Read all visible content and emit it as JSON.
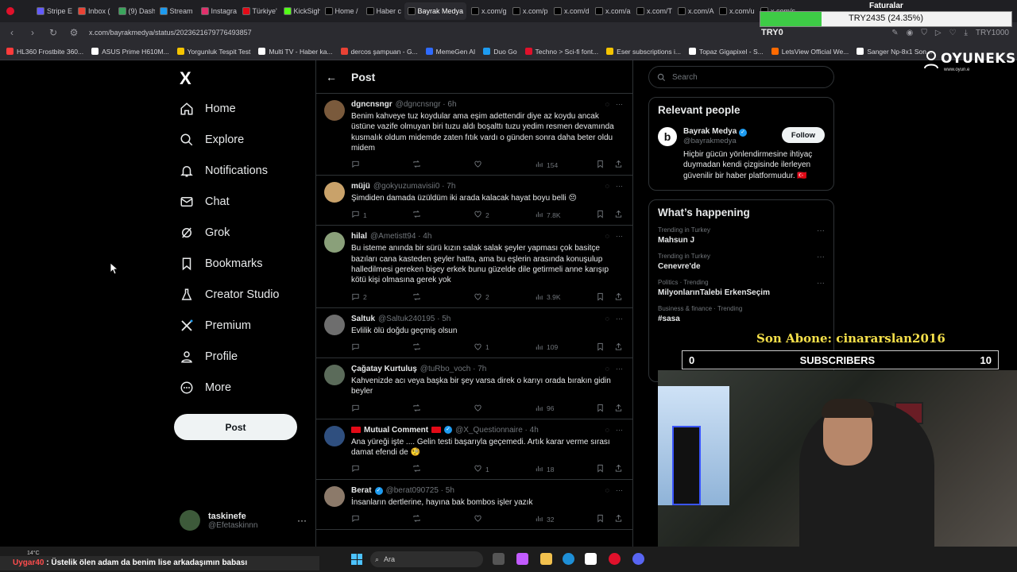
{
  "browser": {
    "tabs": [
      "Stripe E",
      "Inbox (",
      "(9) Dash",
      "Stream",
      "Instagra",
      "Türkiye'",
      "KickSigh",
      "Home /",
      "Haber c",
      "Bayrak Medya",
      "x.com/g",
      "x.com/p",
      "x.com/d",
      "x.com/a",
      "x.com/T",
      "x.com/A",
      "x.com/u",
      "x.com/s"
    ],
    "url": "x.com/bayrakmedya/status/2023621679776493857",
    "bookmarks": [
      "HL360 Frostbite 360...",
      "ASUS Prime H610M...",
      "Yorgunluk Tespit Test",
      "Multi TV - Haber ka...",
      "dercos şampuan - G...",
      "MemeGen AI",
      "Duo Go",
      "Techno > Sci-fi font...",
      "Eser subscriptions i...",
      "Topaz Gigapixel - S...",
      "LetsView Official We...",
      "Sanger Np-8x1 Son..."
    ],
    "right_label": "TRY1000"
  },
  "nav": {
    "logo": "X",
    "items": [
      "Home",
      "Explore",
      "Notifications",
      "Chat",
      "Grok",
      "Bookmarks",
      "Creator Studio",
      "Premium",
      "Profile",
      "More"
    ],
    "post_button": "Post",
    "account_name": "taskinefe",
    "account_handle": "@Efetaskinnn",
    "account_more": "···"
  },
  "timeline": {
    "back": "←",
    "title": "Post",
    "tweets": [
      {
        "name": "dgncnsngr",
        "handle": "@dgncnsngr · 6h",
        "text": "Benim kahveye tuz koydular ama eşim adettendir diye az koydu ancak üstüne vazife olmuyan biri tuzu aldı boşalttı tuzu yedim resmen devamında kusmalık oldum midemde zaten fıtık vardı o günden sonra daha beter oldu midem",
        "replies": "",
        "reposts": "",
        "likes": "",
        "views": "154",
        "color": "#7a5a3c"
      },
      {
        "name": "müjü",
        "handle": "@gokyuzumavisii0 · 7h",
        "text": "Şimdiden damada üzüldüm iki arada kalacak hayat boyu belli 😔",
        "replies": "1",
        "reposts": "",
        "likes": "2",
        "views": "7.8K",
        "color": "#c9a26a"
      },
      {
        "name": "hilal",
        "handle": "@Ametistt94 · 4h",
        "text": "Bu isteme anında bir sürü kızın salak salak şeyler yapması çok basitçe bazıları cana kasteden şeyler hatta, ama bu eşlerin arasında konuşulup halledilmesi gereken bişey erkek bunu güzelde dile getirmeli anne karışıp kötü kişi olmasına gerek yok",
        "replies": "2",
        "reposts": "",
        "likes": "2",
        "views": "3.9K",
        "color": "#8aa07a"
      },
      {
        "name": "Saltuk",
        "handle": "@Saltuk240195 · 5h",
        "text": "Evlilik ölü doğdu geçmiş olsun",
        "replies": "",
        "reposts": "",
        "likes": "1",
        "views": "109",
        "color": "#6e6e6e"
      },
      {
        "name": "Çağatay Kurtuluş",
        "handle": "@tuRbo_voch · 7h",
        "text": "Kahvenizde acı veya başka bir şey varsa direk o karıyı orada bırakın gidin beyler",
        "replies": "",
        "reposts": "",
        "likes": "",
        "views": "96",
        "color": "#5b6b5a"
      },
      {
        "name": "Mutual Comment",
        "handle": "@X_Questionnaire · 4h",
        "text": "Ana yüreği işte  .... Gelin testi başarıyla geçemedi. Artık karar verme sırası damat efendi de 🧐",
        "replies": "",
        "reposts": "",
        "likes": "1",
        "views": "18",
        "color": "#2f4f7f"
      },
      {
        "name": "Berat",
        "handle": "@berat090725 · 5h",
        "text": "İnsanların dertlerine, hayına bak bombos işler yazık",
        "replies": "",
        "reposts": "",
        "likes": "",
        "views": "32",
        "color": "#8c7a6a"
      }
    ]
  },
  "sidebar": {
    "search_placeholder": "Search",
    "relevant_title": "Relevant people",
    "person_name": "Bayrak Medya",
    "person_handle": "@bayrakmedya",
    "follow": "Follow",
    "person_bio": "Hiçbir gücün yönlendirmesine ihtiyaç duymadan kendi çizgisinde ilerleyen güvenilir bir haber platformudur. 🇹🇷",
    "happening_title": "What’s happening",
    "trends": [
      {
        "cat": "Trending in Turkey",
        "name": "Mahsun J"
      },
      {
        "cat": "Trending in Turkey",
        "name": "Cenevre'de"
      },
      {
        "cat": "Politics · Trending",
        "name": "MilyonlarınTalebi ErkenSeçim"
      },
      {
        "cat": "Business & finance · Trending",
        "name": "#sasa"
      }
    ]
  },
  "overlay": {
    "brand": "OYUNEKS",
    "brand_sub": "www.oyun.e",
    "price_top": "Faturalar",
    "price_text": "TRY2435 (24.35%)",
    "price_progress": 0.2435,
    "price_label": "TRY0",
    "son_abone": "Son Abone: cinararslan2016",
    "subs_left": "0",
    "subs_label": "SUBSCRIBERS",
    "subs_right": "10",
    "ticker_user": "Uygar40",
    "ticker_text": " : Üstelik ölen adam da benim lise arkadaşımın babası",
    "weather": "14°C",
    "taskbar_search": "Ara"
  }
}
